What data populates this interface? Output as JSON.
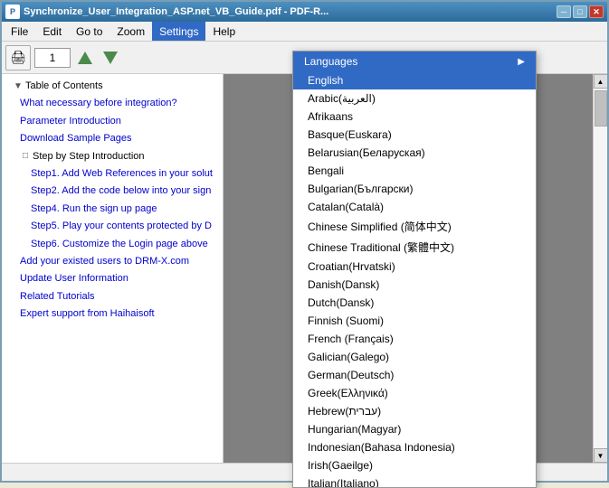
{
  "window": {
    "title": "Synchronize_User_Integration_ASP.net_VB_Guide.pdf - PDF-R...",
    "icon": "PDF"
  },
  "menu": {
    "items": [
      "File",
      "Edit",
      "Go to",
      "Zoom",
      "Settings",
      "Help"
    ]
  },
  "toolbar": {
    "page_number": "1",
    "page_placeholder": "1"
  },
  "languages_header": "Languages",
  "languages": [
    "English",
    "Arabic(العربية)",
    "Afrikaans",
    "Basque(Euskara)",
    "Belarusian(Беларуская)",
    "Bengali",
    "Bulgarian(Български)",
    "Catalan(Català)",
    "Chinese Simplified (简体中文)",
    "Chinese Traditional (繁體中文)",
    "Croatian(Hrvatski)",
    "Danish(Dansk)",
    "Dutch(Dansk)",
    "Finnish (Suomi)",
    "French (Français)",
    "Galician(Galego)",
    "German(Deutsch)",
    "Greek(Ελληνικά)",
    "Hebrew(עברית)",
    "Hungarian(Magyar)",
    "Indonesian(Bahasa Indonesia)",
    "Irish(Gaeilge)",
    "Italian(Italiano)"
  ],
  "toc": {
    "heading": "Table of Contents",
    "items": [
      {
        "label": "What necessary before integration?",
        "indent": 1,
        "link": true
      },
      {
        "label": "Parameter Introduction",
        "indent": 1,
        "link": true
      },
      {
        "label": "Download Sample Pages",
        "indent": 1,
        "link": true
      },
      {
        "label": "Step by Step Introduction",
        "indent": 1,
        "link": false,
        "has_toggle": true
      },
      {
        "label": "Step1. Add Web References in your solut",
        "indent": 2,
        "link": true
      },
      {
        "label": "Step2. Add the code below into your sign",
        "indent": 2,
        "link": true
      },
      {
        "label": "Step4. Run the sign up page",
        "indent": 2,
        "link": true
      },
      {
        "label": "Step5. Play your contents protected by D",
        "indent": 2,
        "link": true
      },
      {
        "label": "Step6. Customize the Login page above",
        "indent": 2,
        "link": true
      },
      {
        "label": "Add your existed users to DRM-X.com",
        "indent": 1,
        "link": true
      },
      {
        "label": "Update User Information",
        "indent": 1,
        "link": true
      },
      {
        "label": "Related Tutorials",
        "indent": 1,
        "link": true
      },
      {
        "label": "Expert support from Haihaisoft",
        "indent": 1,
        "link": true
      }
    ]
  }
}
